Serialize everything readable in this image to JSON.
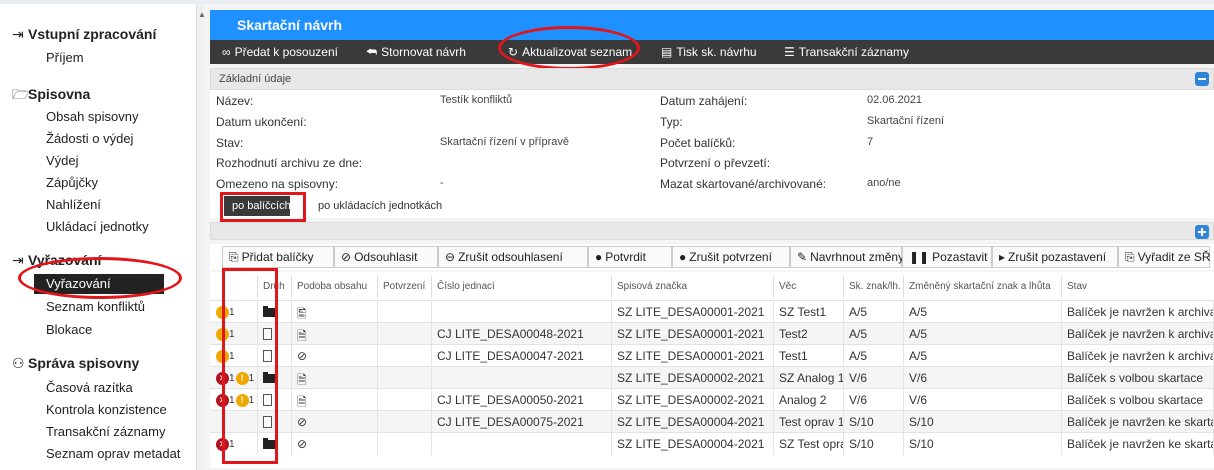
{
  "sidebar": {
    "sections": [
      {
        "title": "Vstupní zpracování",
        "icon": "login-icon",
        "items": [
          "Příjem"
        ]
      },
      {
        "title": "Spisovna",
        "icon": "folder-open-icon",
        "items": [
          "Obsah spisovny",
          "Žádosti o výdej",
          "Výdej",
          "Zápůjčky",
          "Nahlížení",
          "Ukládací jednotky"
        ]
      },
      {
        "title": "Vyřazování",
        "icon": "login-icon",
        "items": [
          "Vyřazování",
          "Seznam konfliktů",
          "Blokace"
        ]
      },
      {
        "title": "Správa spisovny",
        "icon": "users-icon",
        "items": [
          "Časová razítka",
          "Kontrola konzistence",
          "Transakční záznamy",
          "Seznam oprav metadat"
        ]
      }
    ],
    "active_item": "Vyřazování"
  },
  "header": {
    "title": "Skartační návrh"
  },
  "toolbar": {
    "items": [
      {
        "label": "Předat k posouzení",
        "icon": "infinity-icon"
      },
      {
        "label": "Stornovat návrh",
        "icon": "reply-icon"
      },
      {
        "label": "Aktualizovat seznam",
        "icon": "refresh-icon"
      },
      {
        "label": "Tisk sk. návrhu",
        "icon": "document-icon"
      },
      {
        "label": "Transakční záznamy",
        "icon": "list-icon"
      }
    ]
  },
  "details": {
    "heading": "Základní údaje",
    "left": [
      {
        "label": "Název:",
        "value": "Testík konfliktů"
      },
      {
        "label": "Datum ukončení:",
        "value": ""
      },
      {
        "label": "Stav:",
        "value": "Skartační řízení v přípravě"
      },
      {
        "label": "Rozhodnutí archivu ze dne:",
        "value": ""
      },
      {
        "label": "Omezeno na spisovny:",
        "value": "-"
      }
    ],
    "right": [
      {
        "label": "Datum zahájení:",
        "value": "02.06.2021"
      },
      {
        "label": "Typ:",
        "value": "Skartační řízení"
      },
      {
        "label": "Počet balíčků:",
        "value": "7"
      },
      {
        "label": "Potvrzení o převzetí:",
        "value": ""
      },
      {
        "label": "Mazat skartované/archivované:",
        "value": "ano/ne"
      }
    ]
  },
  "tabs": [
    {
      "label": "po balíčcích",
      "active": true
    },
    {
      "label": "po ukládacích jednotkách",
      "active": false
    }
  ],
  "actions": [
    {
      "label": "Přidat balíčky",
      "icon": "add-document-icon"
    },
    {
      "label": "Odsouhlasit",
      "icon": "check-circle-icon"
    },
    {
      "label": "Zrušit odsouhlasení",
      "icon": "minus-circle-icon"
    },
    {
      "label": "Potvrdit",
      "icon": "check-filled-icon"
    },
    {
      "label": "Zrušit potvrzení",
      "icon": "minus-filled-icon"
    },
    {
      "label": "Navrhnout změny",
      "icon": "edit-icon"
    },
    {
      "label": "Pozastavit",
      "icon": "pause-icon"
    },
    {
      "label": "Zrušit pozastavení",
      "icon": "play-icon"
    },
    {
      "label": "Vyřadit ze SŘ",
      "icon": "remove-document-icon"
    }
  ],
  "table": {
    "columns": [
      "",
      "Druh",
      "Podoba obsahu",
      "Potvrzení",
      "Číslo jednací",
      "Spisová značka",
      "Věc",
      "Sk. znak/lh.",
      "Změněný skartační znak a lhůta",
      "Stav"
    ],
    "rows": [
      {
        "err": "",
        "warn": "1",
        "druh": "folder",
        "podoba": "hybrid",
        "cj": "",
        "sz": "SZ LITE_DESA00001-2021",
        "vec": "SZ Test1",
        "znak": "A/5",
        "zmena": "A/5",
        "stav": "Balíček je navržen k archivaci"
      },
      {
        "err": "",
        "warn": "1",
        "druh": "document",
        "podoba": "paper",
        "cj": "CJ LITE_DESA00048-2021",
        "sz": "SZ LITE_DESA00001-2021",
        "vec": "Test2",
        "znak": "A/5",
        "zmena": "A/5",
        "stav": "Balíček je navržen k archivaci"
      },
      {
        "err": "",
        "warn": "1",
        "druh": "document",
        "podoba": "digital",
        "cj": "CJ LITE_DESA00047-2021",
        "sz": "SZ LITE_DESA00001-2021",
        "vec": "Test1",
        "znak": "A/5",
        "zmena": "A/5",
        "stav": "Balíček je navržen k archivaci"
      },
      {
        "err": "1",
        "warn": "1",
        "druh": "folder",
        "podoba": "paper",
        "cj": "",
        "sz": "SZ LITE_DESA00002-2021",
        "vec": "SZ Analog 1",
        "znak": "V/6",
        "zmena": "V/6",
        "stav": "Balíček s volbou skartace"
      },
      {
        "err": "1",
        "warn": "1",
        "druh": "document",
        "podoba": "paper",
        "cj": "CJ LITE_DESA00050-2021",
        "sz": "SZ LITE_DESA00002-2021",
        "vec": "Analog 2",
        "znak": "V/6",
        "zmena": "V/6",
        "stav": "Balíček s volbou skartace"
      },
      {
        "err": "",
        "warn": "",
        "druh": "document",
        "podoba": "digital",
        "cj": "CJ LITE_DESA00075-2021",
        "sz": "SZ LITE_DESA00004-2021",
        "vec": "Test oprav 1",
        "znak": "S/10",
        "zmena": "S/10",
        "stav": "Balíček je navržen ke skartaci"
      },
      {
        "err": "1",
        "warn": "",
        "druh": "folder",
        "podoba": "digital",
        "cj": "",
        "sz": "SZ LITE_DESA00004-2021",
        "vec": "SZ Test oprav",
        "znak": "S/10",
        "zmena": "S/10",
        "stav": "Balíček je navržen ke skartaci"
      }
    ]
  },
  "colors": {
    "accent": "#1e90ff",
    "toolbar": "#3a3a3a",
    "highlight": "#e0161b",
    "warning": "#f0a800",
    "error": "#b3121f"
  }
}
